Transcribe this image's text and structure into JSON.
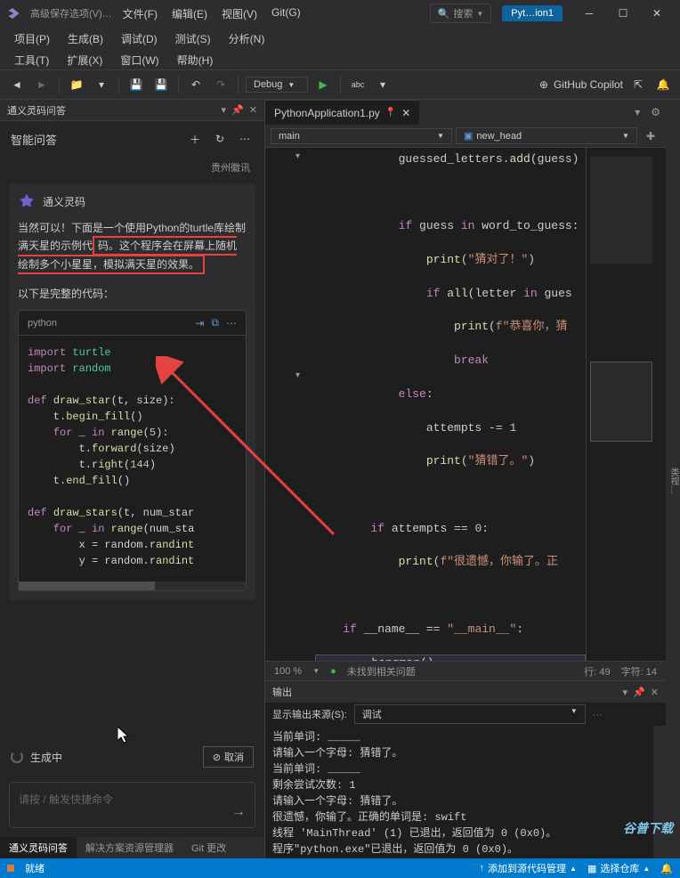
{
  "titlebar": {
    "title_text": "高级保存选项(V)…",
    "menu1": [
      "文件(F)",
      "编辑(E)",
      "视图(V)",
      "Git(G)"
    ],
    "search_label": "搜索",
    "tab_name": "Pyt…ion1"
  },
  "menu2": [
    "项目(P)",
    "生成(B)",
    "调试(D)",
    "测试(S)",
    "分析(N)"
  ],
  "menu3": [
    "工具(T)",
    "扩展(X)",
    "窗口(W)",
    "帮助(H)"
  ],
  "toolbar": {
    "debug_label": "Debug",
    "copilot_label": "GitHub Copilot"
  },
  "left_panel": {
    "header_title": "通义灵码问答",
    "chat_title": "智能问答",
    "chat_sub": "贵州徽讯",
    "assistant_name": "通义灵码",
    "chat_text_pre": "当然可以！下面是一个使用Python的turtle库绘制满天星的示例代",
    "chat_text_boxed": "码。这个程序会在屏幕上随机绘制多个小星星，模拟满天星的效果。",
    "sub_text": "以下是完整的代码：",
    "code_lang": "python",
    "status_text": "生成中",
    "cancel_label": "取消",
    "input_placeholder": "请按 / 触发快捷命令",
    "tabs": [
      "通义灵码问答",
      "解决方案资源管理器",
      "Git 更改"
    ]
  },
  "editor": {
    "tab_name": "PythonApplication1.py",
    "nav_left": "main",
    "nav_right": "new_head",
    "zoom": "100 %",
    "status_ok": "未找到相关问题",
    "line_info": "行: 49",
    "char_info": "字符: 14",
    "right_label": "类视…"
  },
  "output": {
    "title": "输出",
    "src_label": "显示输出来源(S):",
    "src_value": "调试",
    "lines": [
      "当前单词: _____",
      "请输入一个字母: 猜错了。",
      "当前单词: _____",
      "剩余尝试次数: 1",
      "请输入一个字母: 猜错了。",
      "很遗憾，你输了。正确的单词是: swift",
      "线程 'MainThread' (1) 已退出，返回值为 0 (0x0)。",
      "程序\"python.exe\"已退出，返回值为 0 (0x0)。"
    ]
  },
  "statusbar": {
    "ready": "就绪",
    "add_src": "添加到源代码管理",
    "select_repo": "选择仓库"
  },
  "watermark": "谷普下载"
}
